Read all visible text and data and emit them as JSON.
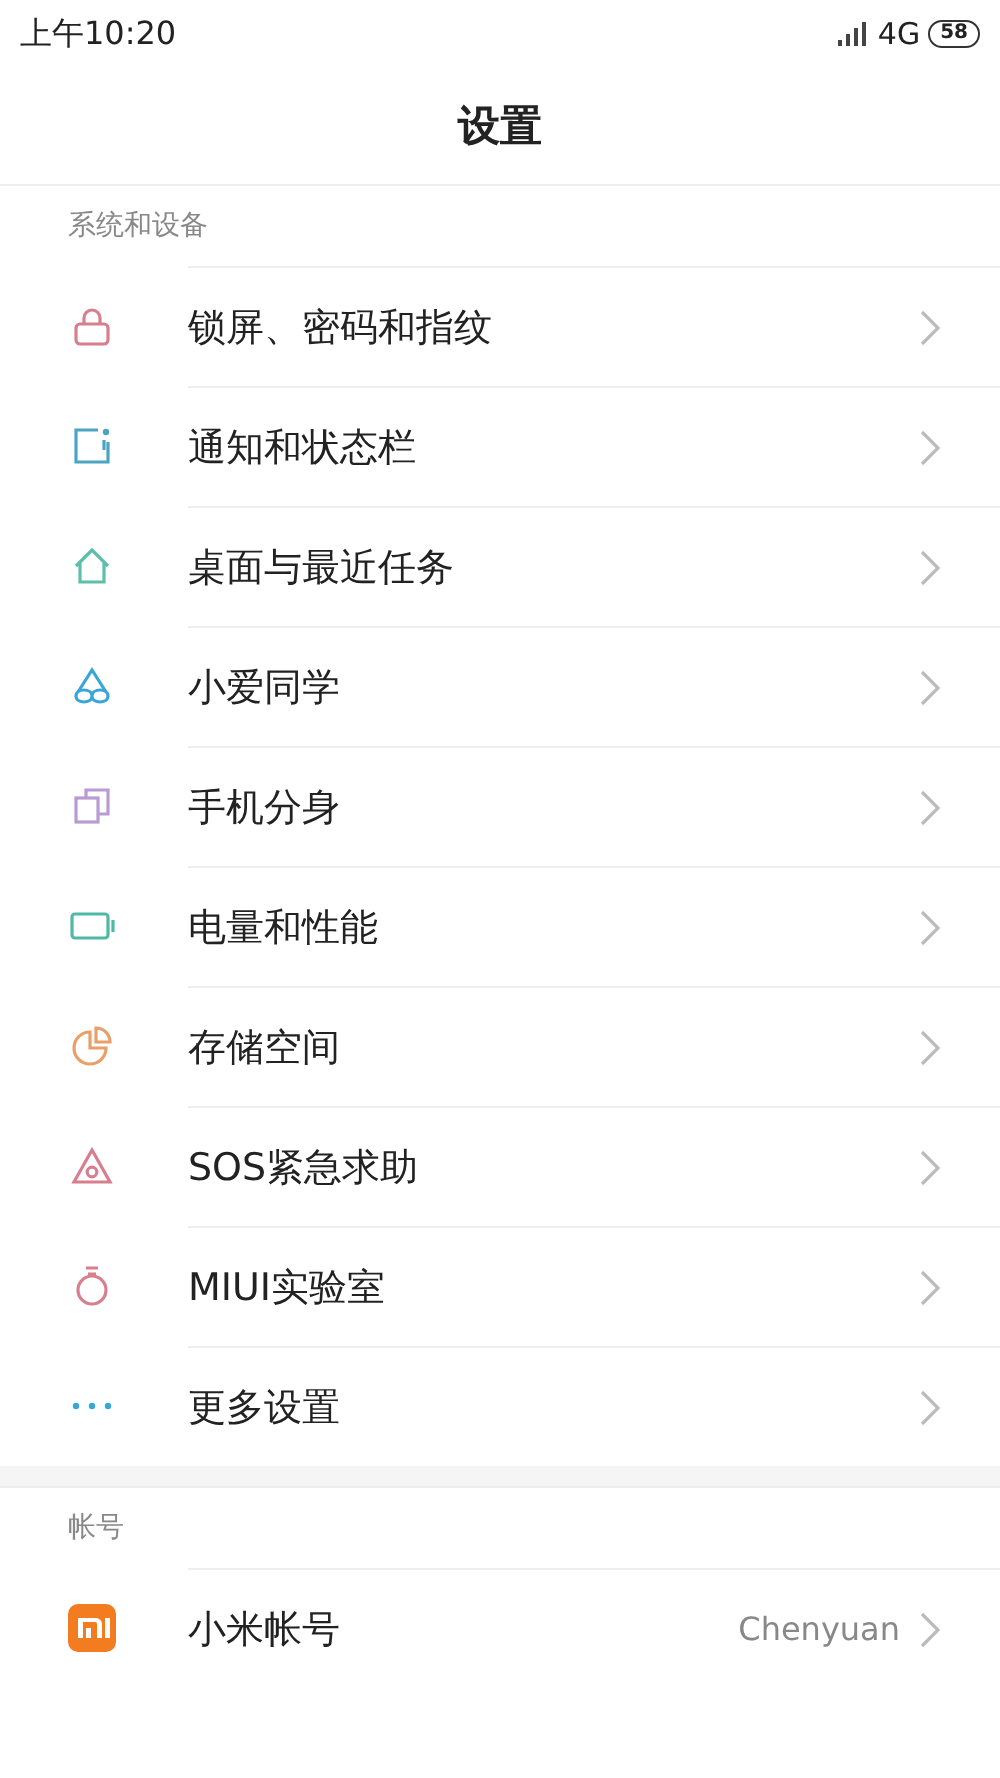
{
  "status_bar": {
    "time": "上午10:20",
    "network": "4G",
    "battery": "58"
  },
  "title": "设置",
  "sections": [
    {
      "header": "系统和设备",
      "items": [
        {
          "kind": "lock",
          "label": "锁屏、密码和指纹"
        },
        {
          "kind": "notification",
          "label": "通知和状态栏"
        },
        {
          "kind": "home",
          "label": "桌面与最近任务"
        },
        {
          "kind": "assistant",
          "label": "小爱同学"
        },
        {
          "kind": "clone",
          "label": "手机分身"
        },
        {
          "kind": "battery",
          "label": "电量和性能"
        },
        {
          "kind": "storage",
          "label": "存储空间"
        },
        {
          "kind": "sos",
          "label": "SOS紧急求助"
        },
        {
          "kind": "lab",
          "label": "MIUI实验室"
        },
        {
          "kind": "more",
          "label": "更多设置"
        }
      ]
    },
    {
      "header": "帐号",
      "items": [
        {
          "kind": "mi",
          "label": "小米帐号",
          "value": "Chenyuan"
        }
      ]
    }
  ]
}
